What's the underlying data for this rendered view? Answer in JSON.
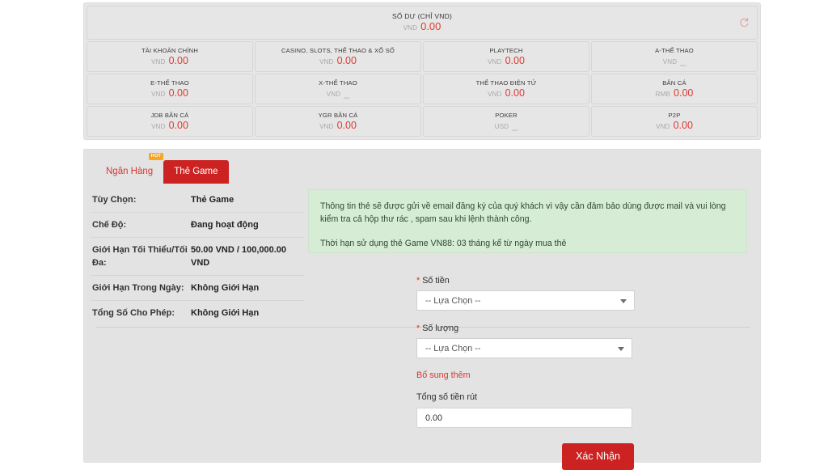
{
  "balance": {
    "total_label": "SỐ DƯ (CHỈ VND)",
    "total_currency": "VND",
    "total_value": "0.00",
    "refresh_icon": "refresh-icon",
    "accounts": [
      {
        "label": "TÀI KHOẢN CHÍNH",
        "currency": "VND",
        "value": "0.00"
      },
      {
        "label": "CASINO, SLOTS, THỂ THAO & XỔ SỐ",
        "currency": "VND",
        "value": "0.00"
      },
      {
        "label": "PLAYTECH",
        "currency": "VND",
        "value": "0.00"
      },
      {
        "label": "A-THỂ THAO",
        "currency": "VND",
        "value": "_"
      },
      {
        "label": "E-THỂ THAO",
        "currency": "VND",
        "value": "0.00"
      },
      {
        "label": "X-THỂ THAO",
        "currency": "VND",
        "value": "_"
      },
      {
        "label": "THỂ THAO ĐIỆN TỬ",
        "currency": "VND",
        "value": "0.00"
      },
      {
        "label": "BẮN CÁ",
        "currency": "RMB",
        "value": "0.00"
      },
      {
        "label": "JDB BẮN CÁ",
        "currency": "VND",
        "value": "0.00"
      },
      {
        "label": "YGR BẮN CÁ",
        "currency": "VND",
        "value": "0.00"
      },
      {
        "label": "POKER",
        "currency": "USD",
        "value": "_"
      },
      {
        "label": "P2P",
        "currency": "VND",
        "value": "0.00"
      }
    ]
  },
  "tabs": {
    "bank_label": "Ngân Hàng",
    "bank_badge": "HOT",
    "game_label": "Thẻ Game"
  },
  "info": {
    "rows": [
      {
        "key": "Tùy Chọn:",
        "value": "Thẻ Game"
      },
      {
        "key": "Chế Độ:",
        "value": "Đang hoạt động"
      },
      {
        "key": "Giới Hạn Tối Thiểu/Tối Đa:",
        "value": "50.00 VND / 100,000.00 VND"
      },
      {
        "key": "Giới Hạn Trong Ngày:",
        "value": "Không Giới Hạn"
      },
      {
        "key": "Tổng Số Cho Phép:",
        "value": "Không Giới Hạn"
      }
    ]
  },
  "notice": {
    "line1": "Thông tin thẻ sẽ được gửi về email đăng ký của quý khách vì vậy cần đảm bảo dùng được mail và vui lòng kiểm tra cả hộp thư rác , spam sau khi lệnh thành công.",
    "line2": "Thời hạn sử dụng thẻ Game VN88: 03 tháng kể từ ngày mua thẻ"
  },
  "form": {
    "amount_label": "Số tiền",
    "amount_value": "-- Lựa Chọn --",
    "quantity_label": "Số lượng",
    "quantity_value": "-- Lựa Chọn --",
    "add_more_link": "Bổ sung thêm",
    "total_label": "Tổng số tiền rút",
    "total_value": "0.00",
    "confirm_label": "Xác Nhận",
    "required_mark": "*"
  },
  "colors": {
    "brand_red": "#cc2222",
    "link_red": "#d9382f",
    "amount_red": "#e03a32",
    "badge_orange": "#f5a623",
    "notice_green_bg": "#d6ecd5",
    "panel_gray": "#e3e3e3"
  }
}
